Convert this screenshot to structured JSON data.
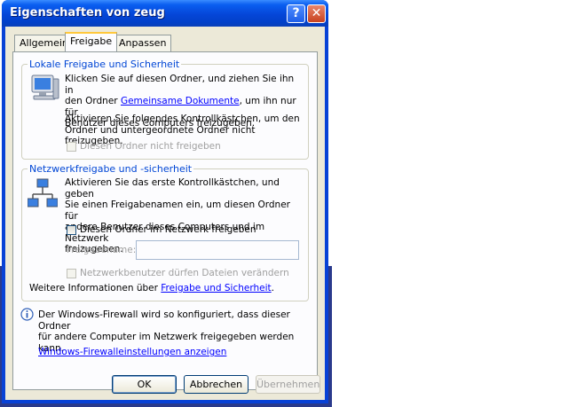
{
  "window": {
    "title": "Eigenschaften von zeug"
  },
  "titlebar": {
    "help": "?",
    "close": "✕"
  },
  "tabs": [
    {
      "label": "Allgemein"
    },
    {
      "label": "Freigabe"
    },
    {
      "label": "Anpassen"
    }
  ],
  "local": {
    "legend": "Lokale Freigabe und Sicherheit",
    "p1_a": "Klicken Sie auf diesen Ordner, und ziehen Sie ihn in",
    "p1_b_pre": "den Ordner ",
    "p1_b_link": "Gemeinsame Dokumente",
    "p1_b_post": ", um ihn nur für",
    "p1_c": "Benutzer dieses Computers freizugeben.",
    "p2_a": "Aktivieren Sie folgendes Kontrollkästchen, um den",
    "p2_b": "Ordner und untergeordnete Ordner nicht freizugeben.",
    "checkbox_label": "Diesen Ordner nicht freigeben"
  },
  "network": {
    "legend": "Netzwerkfreigabe und -sicherheit",
    "p_a": "Aktivieren Sie das erste Kontrollkästchen, und geben",
    "p_b": "Sie einen Freigabenamen ein, um diesen Ordner für",
    "p_c": "andere Benutzer dieses Computers und im Netzwerk",
    "p_d": "freizugeben.",
    "share_checkbox_label": "Diesen Ordner im Netzwerk freigeben",
    "sharename_label": "Freigabename:",
    "sharename_value": "",
    "modify_checkbox_label": "Netzwerkbenutzer dürfen Dateien verändern",
    "more_pre": "Weitere Informationen über ",
    "more_link": "Freigabe und Sicherheit",
    "more_post": "."
  },
  "firewall": {
    "info_a": "Der Windows-Firewall wird so konfiguriert, dass dieser Ordner",
    "info_b": "für andere Computer im Netzwerk freigegeben werden kann.",
    "link": "Windows-Firewalleinstellungen anzeigen"
  },
  "buttons": {
    "ok": "OK",
    "cancel": "Abbrechen",
    "apply": "Übernehmen"
  }
}
